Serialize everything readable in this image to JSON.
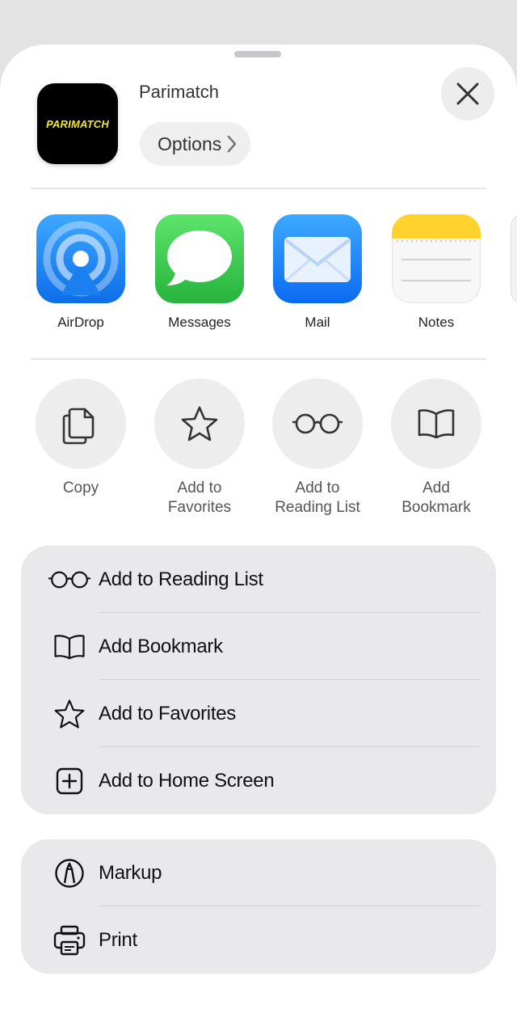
{
  "header": {
    "app_icon_text": "PARIMATCH",
    "app_name": "Parimatch",
    "options_label": "Options"
  },
  "share_apps": [
    {
      "label": "AirDrop",
      "icon": "airdrop-icon"
    },
    {
      "label": "Messages",
      "icon": "messages-icon"
    },
    {
      "label": "Mail",
      "icon": "mail-icon"
    },
    {
      "label": "Notes",
      "icon": "notes-icon"
    }
  ],
  "quick_actions": [
    {
      "label": "Copy",
      "icon": "copy-icon"
    },
    {
      "label": "Add to\nFavorites",
      "icon": "star-icon"
    },
    {
      "label": "Add to\nReading List",
      "icon": "glasses-icon"
    },
    {
      "label": "Add\nBookmark",
      "icon": "book-icon"
    }
  ],
  "action_list_1": [
    {
      "label": "Add to Reading List",
      "icon": "glasses-icon"
    },
    {
      "label": "Add Bookmark",
      "icon": "book-icon"
    },
    {
      "label": "Add to Favorites",
      "icon": "star-icon"
    },
    {
      "label": "Add to Home Screen",
      "icon": "plus-square-icon"
    }
  ],
  "action_list_2": [
    {
      "label": "Markup",
      "icon": "markup-icon"
    },
    {
      "label": "Print",
      "icon": "printer-icon"
    }
  ],
  "colors": {
    "brand_yellow": "#f2ea1c",
    "sheet_bg": "#ffffff",
    "group_bg": "#e9e9eb"
  }
}
